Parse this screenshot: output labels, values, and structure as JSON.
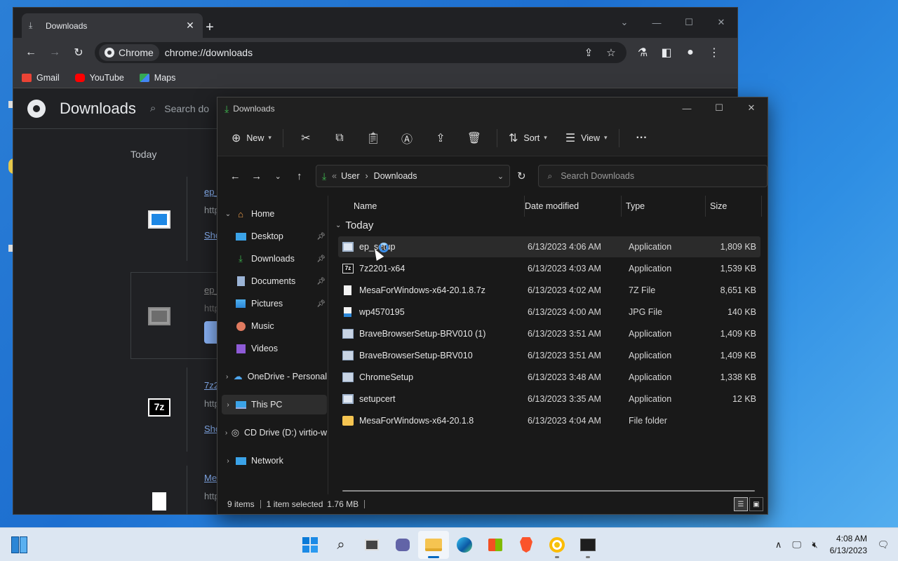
{
  "chrome": {
    "tab_title": "Downloads",
    "site_chip": "Chrome",
    "url": "chrome://downloads",
    "bookmarks": [
      {
        "label": "Gmail",
        "color": "#ea4335"
      },
      {
        "label": "YouTube",
        "color": "#ff0000"
      },
      {
        "label": "Maps",
        "color": "#34a853"
      }
    ],
    "page_title": "Downloads",
    "search_placeholder": "Search do",
    "day_label": "Today",
    "items": [
      {
        "name": "ep_",
        "url": "http",
        "action": "Sho"
      },
      {
        "name": "ep_",
        "url": "http"
      },
      {
        "name": "7z2",
        "url": "http",
        "action": "Sho"
      },
      {
        "name": "Me",
        "url": "http"
      }
    ]
  },
  "explorer": {
    "title": "Downloads",
    "commands": {
      "new": "New",
      "sort": "Sort",
      "view": "View",
      "more": "···"
    },
    "address": {
      "root": "User",
      "current": "Downloads"
    },
    "search_placeholder": "Search Downloads",
    "nav": [
      {
        "label": "Home",
        "icon": "home-icon"
      },
      {
        "label": "Desktop",
        "icon": "desktop-icon",
        "pinned": true
      },
      {
        "label": "Downloads",
        "icon": "download-icon",
        "pinned": true
      },
      {
        "label": "Documents",
        "icon": "document-icon",
        "pinned": true
      },
      {
        "label": "Pictures",
        "icon": "pictures-icon",
        "pinned": true
      },
      {
        "label": "Music",
        "icon": "music-icon"
      },
      {
        "label": "Videos",
        "icon": "videos-icon"
      },
      {
        "label": "OneDrive - Personal",
        "icon": "cloud-icon"
      },
      {
        "label": "This PC",
        "icon": "pc-icon"
      },
      {
        "label": "CD Drive (D:) virtio-w",
        "icon": "cd-drive-icon"
      },
      {
        "label": "Network",
        "icon": "network-icon"
      }
    ],
    "columns": {
      "name": "Name",
      "date": "Date modified",
      "type": "Type",
      "size": "Size"
    },
    "group": "Today",
    "files": [
      {
        "name": "ep_setup",
        "date": "6/13/2023 4:06 AM",
        "type": "Application",
        "size": "1,809 KB",
        "icon": "app-icon"
      },
      {
        "name": "7z2201-x64",
        "date": "6/13/2023 4:03 AM",
        "type": "Application",
        "size": "1,539 KB",
        "icon": "7z-icon"
      },
      {
        "name": "MesaForWindows-x64-20.1.8.7z",
        "date": "6/13/2023 4:02 AM",
        "type": "7Z File",
        "size": "8,651 KB",
        "icon": "file-icon"
      },
      {
        "name": "wp4570195",
        "date": "6/13/2023 4:00 AM",
        "type": "JPG File",
        "size": "140 KB",
        "icon": "image-icon"
      },
      {
        "name": "BraveBrowserSetup-BRV010 (1)",
        "date": "6/13/2023 3:51 AM",
        "type": "Application",
        "size": "1,409 KB",
        "icon": "installer-icon"
      },
      {
        "name": "BraveBrowserSetup-BRV010",
        "date": "6/13/2023 3:51 AM",
        "type": "Application",
        "size": "1,409 KB",
        "icon": "installer-icon"
      },
      {
        "name": "ChromeSetup",
        "date": "6/13/2023 3:48 AM",
        "type": "Application",
        "size": "1,338 KB",
        "icon": "installer-icon"
      },
      {
        "name": "setupcert",
        "date": "6/13/2023 3:35 AM",
        "type": "Application",
        "size": "12 KB",
        "icon": "app-icon"
      },
      {
        "name": "MesaForWindows-x64-20.1.8",
        "date": "6/13/2023 4:04 AM",
        "type": "File folder",
        "size": "",
        "icon": "folder-icon"
      }
    ],
    "status": {
      "count": "9 items",
      "selected": "1 item selected",
      "size": "1.76 MB"
    }
  },
  "taskbar": {
    "time": "4:08 AM",
    "date": "6/13/2023"
  }
}
